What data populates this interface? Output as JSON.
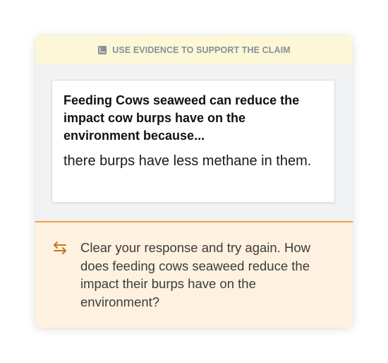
{
  "banner": {
    "icon": "book-icon",
    "label": "USE EVIDENCE TO SUPPORT THE CLAIM"
  },
  "response": {
    "prompt": "Feeding Cows seaweed can reduce the impact cow burps have on the environment because...",
    "answer": "there burps have less methane in them."
  },
  "feedback": {
    "icon": "swap-arrows-icon",
    "text": "Clear your response and try again. How does feeding cows seaweed reduce the impact their burps have on the environment?"
  },
  "colors": {
    "banner_bg": "#fcf7d6",
    "feedback_bg": "#fef1df",
    "accent": "#f0a04a",
    "icon_orange": "#c8731c"
  }
}
